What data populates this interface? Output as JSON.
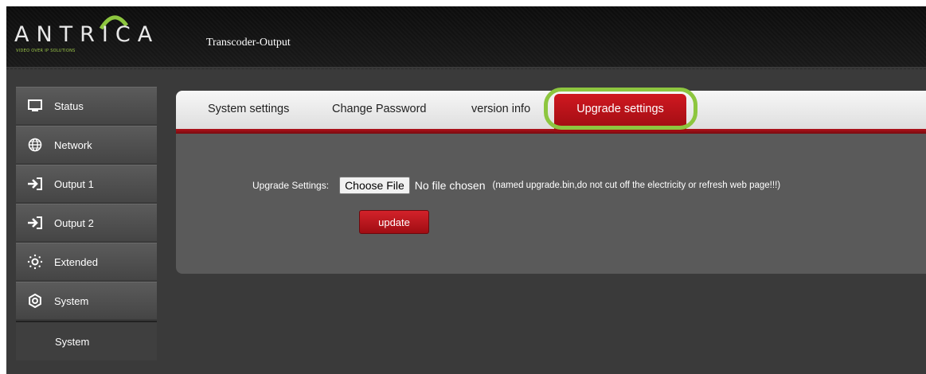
{
  "header": {
    "logo_text": "ANTRICA",
    "logo_tagline": "VIDEO OVER IP SOLUTIONS",
    "page_title": "Transcoder-Output"
  },
  "sidebar": {
    "items": [
      {
        "label": "Status",
        "icon": "monitor-icon"
      },
      {
        "label": "Network",
        "icon": "globe-icon"
      },
      {
        "label": "Output 1",
        "icon": "sign-in-arrow-icon"
      },
      {
        "label": "Output 2",
        "icon": "sign-in-arrow-icon"
      },
      {
        "label": "Extended",
        "icon": "sun-dots-icon"
      },
      {
        "label": "System",
        "icon": "gear-icon"
      }
    ],
    "sub_items": [
      {
        "label": "System"
      }
    ]
  },
  "tabs": {
    "items": [
      {
        "label": "System settings"
      },
      {
        "label": "Change Password"
      },
      {
        "label": "version info"
      }
    ],
    "active": {
      "label": "Upgrade settings"
    }
  },
  "upgrade": {
    "label": "Upgrade Settings:",
    "choose_file": "Choose File",
    "file_status": "No file chosen",
    "note": "(named upgrade.bin,do not cut off the electricity or refresh web page!!!)",
    "update_button": "update"
  },
  "colors": {
    "accent_red": "#b0121a",
    "highlight_green": "#8dc63f",
    "panel_gray": "#5a5a5a"
  }
}
